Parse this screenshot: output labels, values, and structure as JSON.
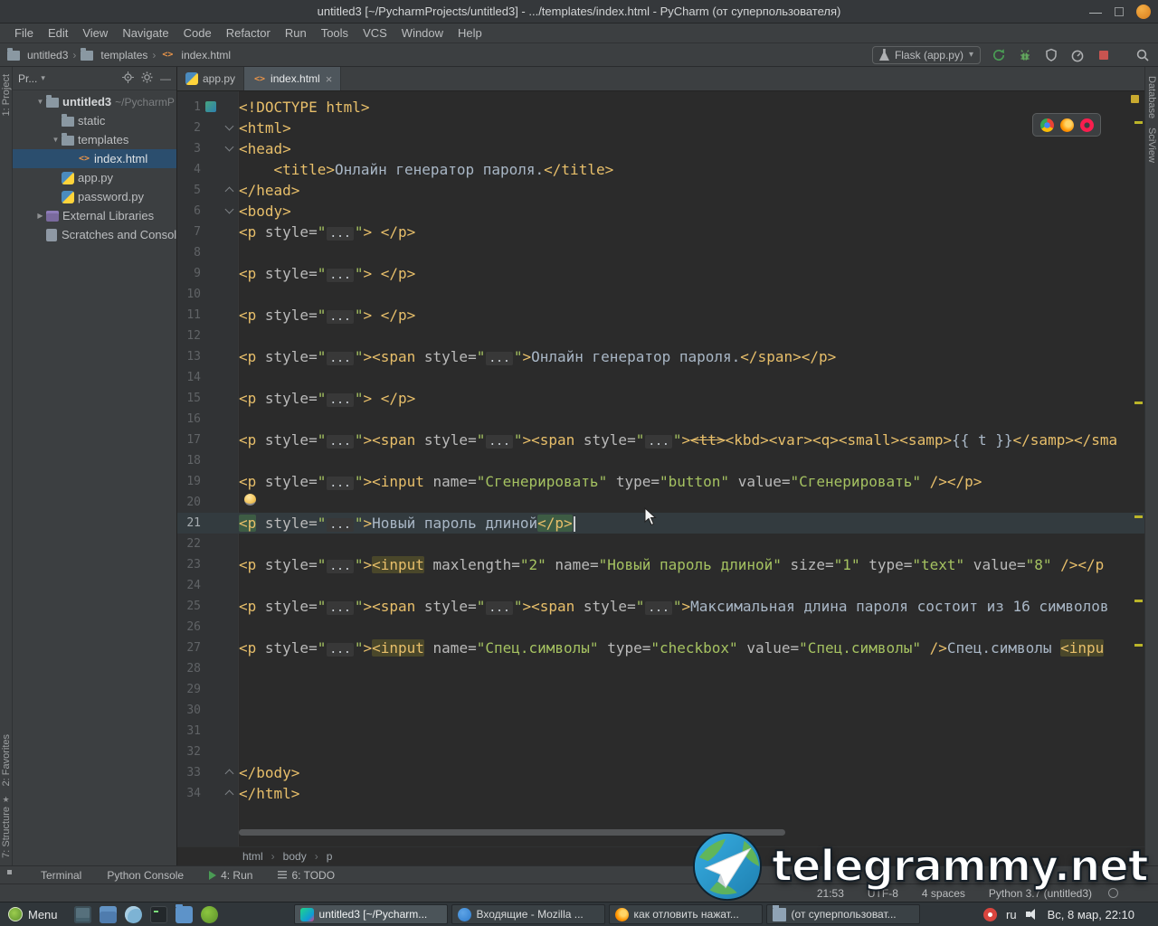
{
  "window": {
    "title": "untitled3 [~/PycharmProjects/untitled3] - .../templates/index.html - PyCharm (от суперпользователя)"
  },
  "menubar": [
    "File",
    "Edit",
    "View",
    "Navigate",
    "Code",
    "Refactor",
    "Run",
    "Tools",
    "VCS",
    "Window",
    "Help"
  ],
  "navbar": {
    "crumbs": [
      {
        "label": "untitled3",
        "icon": "folder"
      },
      {
        "label": "templates",
        "icon": "folder"
      },
      {
        "label": "index.html",
        "icon": "html"
      }
    ],
    "run_config": "Flask (app.py)",
    "dropdown_arrow": "▾"
  },
  "stripes": {
    "left": [
      "1: Project",
      "2: Favorites",
      "7: Structure"
    ],
    "right": [
      "Database",
      "SciView"
    ]
  },
  "project_panel": {
    "header": "Pr...",
    "hide_label": "—",
    "tree": [
      {
        "label": "untitled3",
        "suffix": "~/PycharmP",
        "icon": "folder",
        "arrow": "v",
        "indent": 0,
        "bold": true
      },
      {
        "label": "static",
        "icon": "folder",
        "indent": 1
      },
      {
        "label": "templates",
        "icon": "folder",
        "arrow": "v",
        "indent": 1
      },
      {
        "label": "index.html",
        "icon": "html",
        "indent": 2,
        "selected": true
      },
      {
        "label": "app.py",
        "icon": "py",
        "indent": 1
      },
      {
        "label": "password.py",
        "icon": "py",
        "indent": 1
      },
      {
        "label": "External Libraries",
        "icon": "lib",
        "arrow": ">",
        "indent": 0
      },
      {
        "label": "Scratches and Consoles",
        "icon": "scratch",
        "indent": 0
      }
    ]
  },
  "tabs": [
    {
      "label": "app.py",
      "icon": "py",
      "active": false
    },
    {
      "label": "index.html",
      "icon": "html",
      "active": true,
      "closable": true,
      "close_glyph": "×"
    }
  ],
  "editor": {
    "breadcrumbs": [
      "html",
      "body",
      "p"
    ],
    "lines": [
      {
        "n": 1,
        "s": [
          [
            "t",
            "<!DOCTYPE html>"
          ]
        ]
      },
      {
        "n": 2,
        "fold": "v",
        "s": [
          [
            "t",
            "<html>"
          ]
        ]
      },
      {
        "n": 3,
        "fold": "v",
        "s": [
          [
            "t",
            "<head>"
          ]
        ]
      },
      {
        "n": 4,
        "s": [
          [
            "p",
            "    "
          ],
          [
            "t",
            "<title>"
          ],
          [
            "p",
            "Онлайн генератор пароля."
          ],
          [
            "t",
            "</title>"
          ]
        ]
      },
      {
        "n": 5,
        "fold": "u",
        "s": [
          [
            "t",
            "</head>"
          ]
        ]
      },
      {
        "n": 6,
        "fold": "v",
        "s": [
          [
            "t",
            "<body>"
          ]
        ]
      },
      {
        "n": 7,
        "s": [
          [
            "t",
            "<p"
          ],
          [
            "a",
            " style="
          ],
          [
            "v",
            "\""
          ],
          [
            "f",
            "..."
          ],
          [
            "v",
            "\""
          ],
          [
            "t",
            ">"
          ],
          [
            "p",
            " "
          ],
          [
            "t",
            "</p>"
          ]
        ]
      },
      {
        "n": 8,
        "s": []
      },
      {
        "n": 9,
        "s": [
          [
            "t",
            "<p"
          ],
          [
            "a",
            " style="
          ],
          [
            "v",
            "\""
          ],
          [
            "f",
            "..."
          ],
          [
            "v",
            "\""
          ],
          [
            "t",
            ">"
          ],
          [
            "p",
            " "
          ],
          [
            "t",
            "</p>"
          ]
        ]
      },
      {
        "n": 10,
        "s": []
      },
      {
        "n": 11,
        "s": [
          [
            "t",
            "<p"
          ],
          [
            "a",
            " style="
          ],
          [
            "v",
            "\""
          ],
          [
            "f",
            "..."
          ],
          [
            "v",
            "\""
          ],
          [
            "t",
            ">"
          ],
          [
            "p",
            " "
          ],
          [
            "t",
            "</p>"
          ]
        ]
      },
      {
        "n": 12,
        "s": []
      },
      {
        "n": 13,
        "s": [
          [
            "t",
            "<p"
          ],
          [
            "a",
            " style="
          ],
          [
            "v",
            "\""
          ],
          [
            "f",
            "..."
          ],
          [
            "v",
            "\""
          ],
          [
            "t",
            "><span"
          ],
          [
            "a",
            " style="
          ],
          [
            "v",
            "\""
          ],
          [
            "f",
            "..."
          ],
          [
            "v",
            "\""
          ],
          [
            "t",
            ">"
          ],
          [
            "p",
            "Онлайн генератор пароля."
          ],
          [
            "t",
            "</span></p>"
          ]
        ]
      },
      {
        "n": 14,
        "s": []
      },
      {
        "n": 15,
        "s": [
          [
            "t",
            "<p"
          ],
          [
            "a",
            " style="
          ],
          [
            "v",
            "\""
          ],
          [
            "f",
            "..."
          ],
          [
            "v",
            "\""
          ],
          [
            "t",
            ">"
          ],
          [
            "p",
            " "
          ],
          [
            "t",
            "</p>"
          ]
        ]
      },
      {
        "n": 16,
        "s": []
      },
      {
        "n": 17,
        "s": [
          [
            "t",
            "<p"
          ],
          [
            "a",
            " style="
          ],
          [
            "v",
            "\""
          ],
          [
            "f",
            "..."
          ],
          [
            "v",
            "\""
          ],
          [
            "t",
            "><span"
          ],
          [
            "a",
            " style="
          ],
          [
            "v",
            "\""
          ],
          [
            "f",
            "..."
          ],
          [
            "v",
            "\""
          ],
          [
            "t",
            "><span"
          ],
          [
            "a",
            " style="
          ],
          [
            "v",
            "\""
          ],
          [
            "f",
            "..."
          ],
          [
            "v",
            "\""
          ],
          [
            "t",
            ">"
          ],
          [
            "x",
            "<tt>"
          ],
          [
            "t",
            "<kbd><var><q><small><samp>"
          ],
          [
            "p",
            "{{ t }}"
          ],
          [
            "t",
            "</samp></sma"
          ]
        ]
      },
      {
        "n": 18,
        "s": []
      },
      {
        "n": 19,
        "s": [
          [
            "t",
            "<p"
          ],
          [
            "a",
            " style="
          ],
          [
            "v",
            "\""
          ],
          [
            "f",
            "..."
          ],
          [
            "v",
            "\""
          ],
          [
            "t",
            "><input"
          ],
          [
            "a",
            " name="
          ],
          [
            "v",
            "\"Сгенерировать\""
          ],
          [
            "a",
            " type="
          ],
          [
            "v",
            "\"button\""
          ],
          [
            "a",
            " value="
          ],
          [
            "v",
            "\"Сгенерировать\""
          ],
          [
            "t",
            " /></p>"
          ]
        ]
      },
      {
        "n": 20,
        "s": []
      },
      {
        "n": 21,
        "cur": true,
        "s": [
          [
            "m",
            "<p"
          ],
          [
            "a",
            " style="
          ],
          [
            "v",
            "\""
          ],
          [
            "f",
            "..."
          ],
          [
            "v",
            "\""
          ],
          [
            "t",
            ">"
          ],
          [
            "p",
            "Новый пароль длиной"
          ],
          [
            "m",
            "</p>"
          ],
          [
            "c",
            ""
          ]
        ]
      },
      {
        "n": 22,
        "s": []
      },
      {
        "n": 23,
        "s": [
          [
            "t",
            "<p"
          ],
          [
            "a",
            " style="
          ],
          [
            "v",
            "\""
          ],
          [
            "f",
            "..."
          ],
          [
            "v",
            "\""
          ],
          [
            "t",
            ">"
          ],
          [
            "i",
            "<input"
          ],
          [
            "a",
            " maxlength="
          ],
          [
            "v",
            "\"2\""
          ],
          [
            "a",
            " name="
          ],
          [
            "v",
            "\"Новый пароль длиной\""
          ],
          [
            "a",
            " size="
          ],
          [
            "v",
            "\"1\""
          ],
          [
            "a",
            " type="
          ],
          [
            "v",
            "\"text\""
          ],
          [
            "a",
            " value="
          ],
          [
            "v",
            "\"8\""
          ],
          [
            "t",
            " /></p"
          ]
        ]
      },
      {
        "n": 24,
        "s": []
      },
      {
        "n": 25,
        "s": [
          [
            "t",
            "<p"
          ],
          [
            "a",
            " style="
          ],
          [
            "v",
            "\""
          ],
          [
            "f",
            "..."
          ],
          [
            "v",
            "\""
          ],
          [
            "t",
            "><span"
          ],
          [
            "a",
            " style="
          ],
          [
            "v",
            "\""
          ],
          [
            "f",
            "..."
          ],
          [
            "v",
            "\""
          ],
          [
            "t",
            "><span"
          ],
          [
            "a",
            " style="
          ],
          [
            "v",
            "\""
          ],
          [
            "f",
            "..."
          ],
          [
            "v",
            "\""
          ],
          [
            "t",
            ">"
          ],
          [
            "p",
            "Максимальная длина пароля состоит из 16 символов"
          ]
        ]
      },
      {
        "n": 26,
        "s": []
      },
      {
        "n": 27,
        "s": [
          [
            "t",
            "<p"
          ],
          [
            "a",
            " style="
          ],
          [
            "v",
            "\""
          ],
          [
            "f",
            "..."
          ],
          [
            "v",
            "\""
          ],
          [
            "t",
            ">"
          ],
          [
            "i",
            "<input"
          ],
          [
            "a",
            " name="
          ],
          [
            "v",
            "\"Спец.символы\""
          ],
          [
            "a",
            " type="
          ],
          [
            "v",
            "\"checkbox\""
          ],
          [
            "a",
            " value="
          ],
          [
            "v",
            "\"Спец.символы\""
          ],
          [
            "t",
            " />"
          ],
          [
            "p",
            "Спец.символы "
          ],
          [
            "i",
            "<inpu"
          ]
        ]
      },
      {
        "n": 28,
        "s": []
      },
      {
        "n": 29,
        "s": []
      },
      {
        "n": 30,
        "s": []
      },
      {
        "n": 31,
        "s": []
      },
      {
        "n": 32,
        "s": []
      },
      {
        "n": 33,
        "fold": "u",
        "s": [
          [
            "t",
            "</body>"
          ]
        ]
      },
      {
        "n": 34,
        "fold": "u",
        "s": [
          [
            "t",
            "</html>"
          ]
        ]
      }
    ]
  },
  "bottom_bar": {
    "items": [
      {
        "label": "Terminal"
      },
      {
        "label": "Python Console"
      },
      {
        "label": "4: Run",
        "icon": "run"
      },
      {
        "label": "6: TODO",
        "icon": "todo"
      }
    ]
  },
  "statusbar": {
    "caret": "21:53",
    "encoding": "UTF-8",
    "indent": "4 spaces",
    "interpreter": "Python 3.7 (untitled3)"
  },
  "taskbar": {
    "menu": "Menu",
    "windows": [
      {
        "label": "untitled3 [~/Pycharm...",
        "icon": "pycharm",
        "active": true
      },
      {
        "label": "Входящие - Mozilla ...",
        "icon": "thunderbird"
      },
      {
        "label": "как отловить нажат...",
        "icon": "firefox"
      },
      {
        "label": "(от суперпользоват...",
        "icon": "files"
      }
    ],
    "tray": {
      "layout": "ru",
      "clock": "Вс, 8 мар, 22:10"
    }
  },
  "watermark": {
    "text": "telegrammy.net"
  }
}
